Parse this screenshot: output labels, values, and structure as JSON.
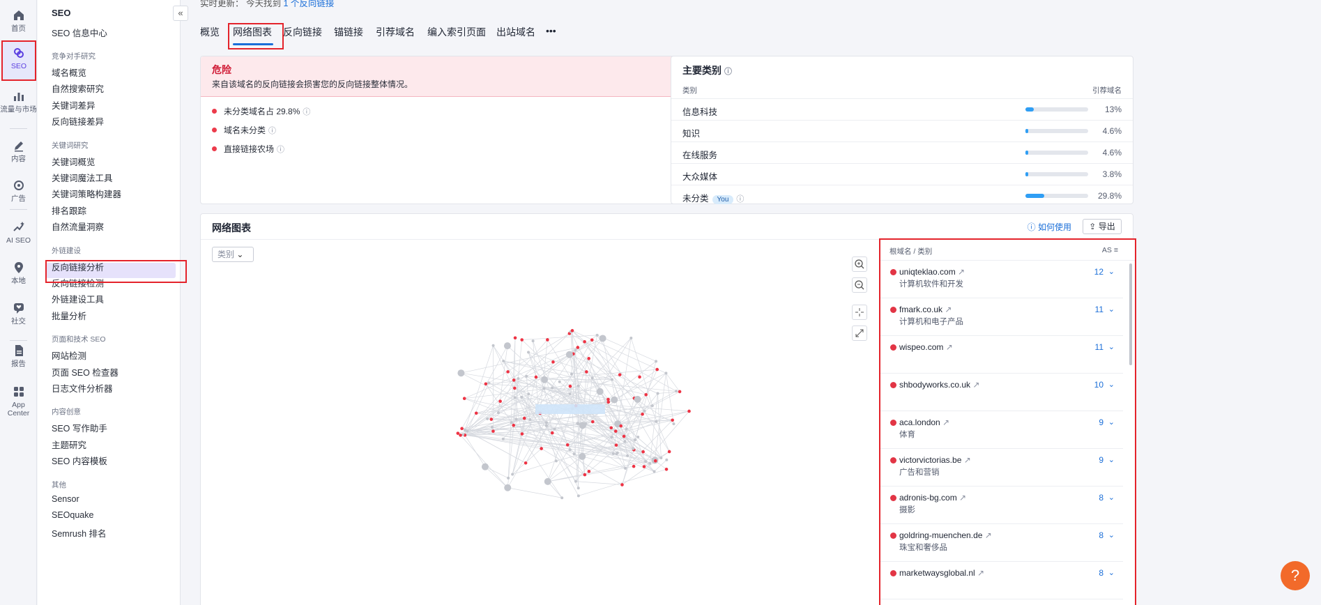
{
  "rail": {
    "items": [
      {
        "label": "首页",
        "icon": "home-icon"
      },
      {
        "label": "SEO",
        "icon": "seo-icon"
      },
      {
        "label": "流量与市场",
        "icon": "bar-chart-icon"
      },
      {
        "label": "内容",
        "icon": "pen-icon"
      },
      {
        "label": "广告",
        "icon": "target-icon"
      },
      {
        "label": "AI SEO",
        "icon": "sparkle-icon"
      },
      {
        "label": "本地",
        "icon": "pin-icon"
      },
      {
        "label": "社交",
        "icon": "heart-chat-icon"
      },
      {
        "label": "报告",
        "icon": "document-icon"
      },
      {
        "label": "App Center",
        "icon": "apps-grid-icon"
      }
    ]
  },
  "sidebar": {
    "title": "SEO",
    "hub": "SEO 信息中心",
    "sections": [
      {
        "title": "竞争对手研究",
        "items": [
          "域名概览",
          "自然搜索研究",
          "关键词差异",
          "反向链接差异"
        ]
      },
      {
        "title": "关键词研究",
        "items": [
          "关键词概览",
          "关键词魔法工具",
          "关键词策略构建器",
          "排名跟踪",
          "自然流量洞察"
        ]
      },
      {
        "title": "外链建设",
        "items": [
          "反向链接分析",
          "反向链接检测",
          "外链建设工具",
          "批量分析"
        ]
      },
      {
        "title": "页面和技术 SEO",
        "items": [
          "网站检测",
          "页面 SEO 检查器",
          "日志文件分析器"
        ]
      },
      {
        "title": "内容创意",
        "items": [
          "SEO 写作助手",
          "主题研究",
          "SEO 内容模板"
        ]
      },
      {
        "title": "其他",
        "items": [
          "Sensor",
          "SEOquake",
          "Semrush 排名"
        ]
      }
    ]
  },
  "top": {
    "prefix": "实时更新： 今天找到",
    "link": "1 个反向链接"
  },
  "tabs": [
    "概览",
    "网络图表",
    "反向链接",
    "锚链接",
    "引荐域名",
    "编入索引页面",
    "出站域名",
    "•••"
  ],
  "danger": {
    "title": "危险",
    "desc": "来自该域名的反向链接会损害您的反向链接整体情况。",
    "items": [
      "未分类域名占 29.8%",
      "域名未分类",
      "直接链接农场"
    ]
  },
  "categories": {
    "title": "主要类别",
    "col1": "类别",
    "col2": "引荐域名",
    "rows": [
      {
        "name": "信息科技",
        "pct": "13%",
        "value": 13
      },
      {
        "name": "知识",
        "pct": "4.6%",
        "value": 4.6
      },
      {
        "name": "在线服务",
        "pct": "4.6%",
        "value": 4.6
      },
      {
        "name": "大众媒体",
        "pct": "3.8%",
        "value": 3.8
      },
      {
        "name": "未分类",
        "pct": "29.8%",
        "value": 29.8,
        "badge": "You"
      }
    ]
  },
  "graph": {
    "title": "网络图表",
    "howto": "如何使用",
    "export": "导出",
    "filter": "类别"
  },
  "domains": {
    "col1": "根域名 / 类别",
    "col2": "AS",
    "rows": [
      {
        "domain": "uniqteklao.com",
        "category": "计算机软件和开发",
        "as": "12"
      },
      {
        "domain": "fmark.co.uk",
        "category": "计算机和电子产品",
        "as": "11"
      },
      {
        "domain": "wispeo.com",
        "category": "",
        "as": "11"
      },
      {
        "domain": "shbodyworks.co.uk",
        "category": "",
        "as": "10"
      },
      {
        "domain": "aca.london",
        "category": "体育",
        "as": "9"
      },
      {
        "domain": "victorvictorias.be",
        "category": "广告和营销",
        "as": "9"
      },
      {
        "domain": "adronis-bg.com",
        "category": "摄影",
        "as": "8"
      },
      {
        "domain": "goldring-muenchen.de",
        "category": "珠宝和奢侈品",
        "as": "8"
      },
      {
        "domain": "marketwaysglobal.nl",
        "category": "",
        "as": "8"
      }
    ]
  },
  "colors": {
    "accent": "#1a6ed8",
    "danger": "#d01a35",
    "highlight": "#e4232b",
    "fab": "#f26a2a"
  }
}
